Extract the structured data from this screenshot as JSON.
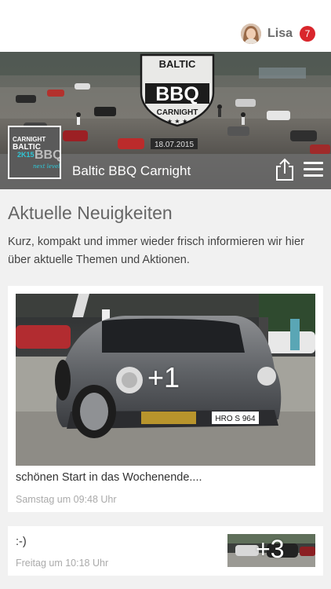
{
  "header": {
    "user_name": "Lisa",
    "notification_count": "7"
  },
  "hero": {
    "club_name": "Baltic BBQ Carnight",
    "banner_line1": "BALTIC",
    "banner_line2": "BBQ",
    "banner_line3": "CARNIGHT",
    "banner_date": "18.07.2015",
    "logo_line1": "CARNIGHT",
    "logo_line2": "BALTIC",
    "logo_line3": "2K15",
    "logo_line4": "BBQ",
    "logo_line5": "next level"
  },
  "news": {
    "title": "Aktuelle Neuigkeiten",
    "description": "Kurz, kompakt und immer wieder frisch informieren wir hier über aktuelle Themen und Aktionen."
  },
  "posts": [
    {
      "text": "schönen Start in das Wochenende....",
      "time": "Samstag um 09:48 Uhr",
      "photo_count": "+1",
      "plate": "HRO S 964"
    },
    {
      "text": ":-)",
      "time": "Freitag um 10:18 Uhr",
      "photo_count": "+3"
    }
  ],
  "colors": {
    "badge": "#d9262c",
    "hero_bar": "#6e6e6e"
  }
}
